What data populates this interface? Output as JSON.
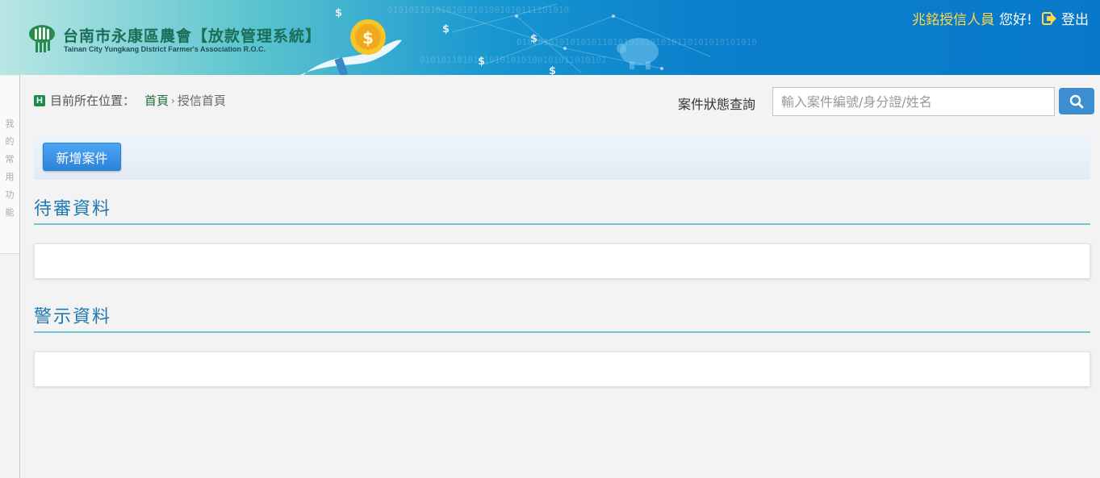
{
  "header": {
    "title": "台南市永康區農會【放款管理系統】",
    "subtitle": "Tainan City Yungkang District Farmer's Association R.O.C.",
    "user_name": "兆銘授信人員",
    "greeting": "您好!",
    "logout_label": "登出"
  },
  "side_tab": {
    "label": "我的常用功能"
  },
  "breadcrumb": {
    "prefix": "目前所在位置：",
    "home": "首頁",
    "separator": "›",
    "current": "授信首頁"
  },
  "search": {
    "label": "案件狀態查詢",
    "placeholder": "輸入案件編號/身分證/姓名",
    "value": ""
  },
  "toolbar": {
    "add_label": "新增案件"
  },
  "sections": [
    {
      "title": "待審資料"
    },
    {
      "title": "警示資料"
    }
  ],
  "colors": {
    "accent": "#1e79b3",
    "button": "#3c8ed0",
    "user_name": "#ffd84a"
  }
}
